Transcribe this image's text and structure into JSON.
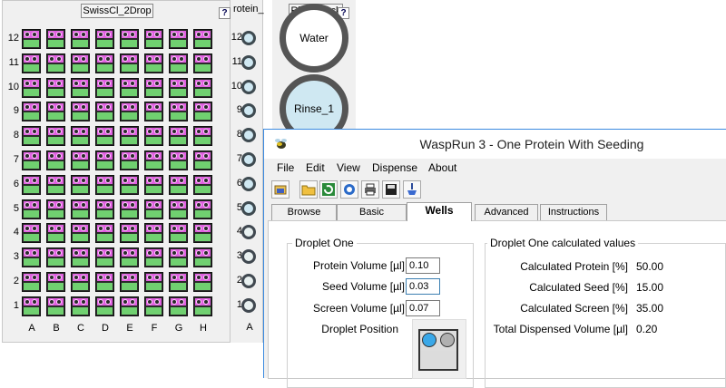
{
  "plate": {
    "title": "SwissCl_2Drop",
    "help": "?",
    "rows": [
      "12",
      "11",
      "10",
      "9",
      "8",
      "7",
      "6",
      "5",
      "4",
      "3",
      "2",
      "1"
    ],
    "columns": [
      "A",
      "B",
      "C",
      "D",
      "E",
      "F",
      "G",
      "H"
    ]
  },
  "protein": {
    "title": "rotein_",
    "wells": [
      "12",
      "11",
      "10",
      "9",
      "8",
      "7",
      "6",
      "5",
      "4",
      "3",
      "2",
      "1"
    ],
    "column": "A"
  },
  "rinse": {
    "title": "RinseBlock",
    "help": "?",
    "wells": [
      "Water",
      "Rinse_1"
    ]
  },
  "window": {
    "title": "WaspRun 3 -  One Protein With Seeding",
    "menu": [
      "File",
      "Edit",
      "View",
      "Dispense",
      "About"
    ],
    "toolbar": [
      "open-icon",
      "folder-icon",
      "refresh-icon",
      "run-icon",
      "print-icon",
      "save-icon",
      "dispense-icon"
    ],
    "tabs": [
      "Browse",
      "Basic",
      "Wells",
      "Advanced",
      "Instructions"
    ],
    "active_tab": "Wells"
  },
  "droplet": {
    "group_title": "Droplet One",
    "protein_label": "Protein Volume [µl]",
    "protein_value": "0.10",
    "seed_label": "Seed Volume [µl]",
    "seed_value": "0.03",
    "screen_label": "Screen Volume [µl]",
    "screen_value": "0.07",
    "position_label": "Droplet Position"
  },
  "calculated": {
    "group_title": "Droplet One calculated values",
    "protein_label": "Calculated Protein [%]",
    "protein_value": "50.00",
    "seed_label": "Calculated Seed [%]",
    "seed_value": "15.00",
    "screen_label": "Calculated Screen [%]",
    "screen_value": "35.00",
    "total_label": "Total Dispensed Volume [µl]",
    "total_value": "0.20"
  },
  "colors": {
    "well_top": "#e060e0",
    "well_bottom": "#70d070",
    "accent": "#3b8ae0"
  }
}
